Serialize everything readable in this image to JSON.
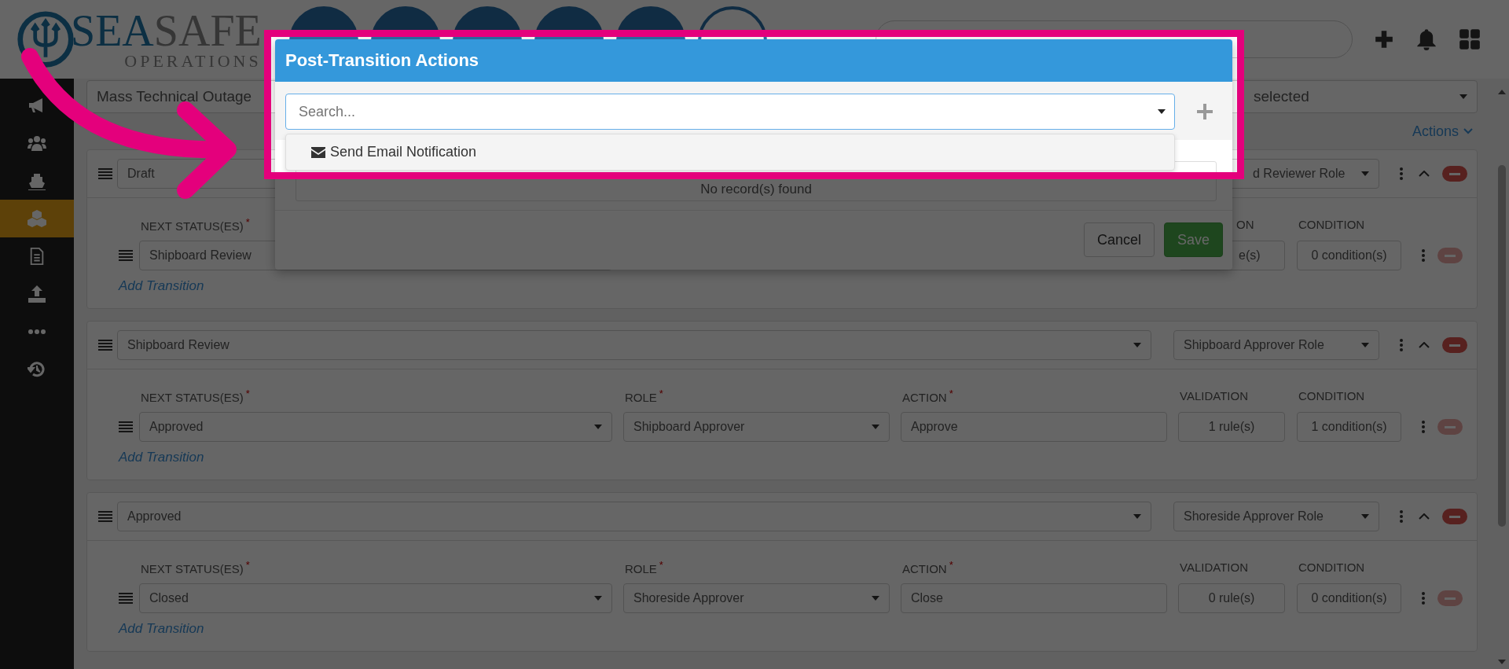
{
  "header": {
    "logo": {
      "brand_first": "SEA",
      "brand_second": "SAFE",
      "tagline": "OPERATIONS"
    },
    "nav_buttons": [
      {
        "kind": "filled"
      },
      {
        "kind": "filled"
      },
      {
        "kind": "filled"
      },
      {
        "kind": "filled"
      },
      {
        "kind": "filled"
      },
      {
        "kind": "outline"
      }
    ]
  },
  "sidebar": {
    "items": [
      {
        "selected": false
      },
      {
        "selected": false
      },
      {
        "selected": false
      },
      {
        "selected": true
      },
      {
        "selected": false
      },
      {
        "selected": false
      },
      {
        "selected": false
      },
      {
        "selected": false
      }
    ]
  },
  "filters": {
    "outage_type": "Mass Technical Outage",
    "selection": "selected"
  },
  "actions_link": "Actions",
  "sections": [
    {
      "status": "Draft",
      "role": "d Reviewer Role",
      "remove_disabled": false,
      "transitions": [
        {
          "next_status_label": {
            "text": "NEXT STATUS(ES)",
            "required_mark": "*"
          },
          "next_status": "Shipboard Review",
          "validation_label": "ON",
          "validation": "e(s)",
          "condition_label": "CONDITION",
          "condition": "0 condition(s)",
          "remove_disabled": true
        }
      ],
      "add_transition": "Add Transition"
    },
    {
      "status": "Shipboard Review",
      "role": "Shipboard Approver Role",
      "remove_disabled": false,
      "transitions": [
        {
          "next_status_label": {
            "text": "NEXT STATUS(ES)",
            "required_mark": "*"
          },
          "next_status": "Approved",
          "role_label": {
            "text": "ROLE",
            "required_mark": "*"
          },
          "role": "Shipboard Approver",
          "action_label": {
            "text": "ACTION",
            "required_mark": "*"
          },
          "action": "Approve",
          "validation_label": "VALIDATION",
          "validation": "1 rule(s)",
          "condition_label": "CONDITION",
          "condition": "1 condition(s)",
          "remove_disabled": true
        }
      ],
      "add_transition": "Add Transition"
    },
    {
      "status": "Approved",
      "role": "Shoreside Approver Role",
      "remove_disabled": false,
      "transitions": [
        {
          "next_status_label": {
            "text": "NEXT STATUS(ES)",
            "required_mark": "*"
          },
          "next_status": "Closed",
          "role_label": {
            "text": "ROLE",
            "required_mark": "*"
          },
          "role": "Shoreside Approver",
          "action_label": {
            "text": "ACTION",
            "required_mark": "*"
          },
          "action": "Close",
          "validation_label": "VALIDATION",
          "validation": "0 rule(s)",
          "condition_label": "CONDITION",
          "condition": "0 condition(s)",
          "remove_disabled": true
        }
      ],
      "add_transition": "Add Transition"
    }
  ],
  "modal": {
    "title": "Post-Transition Actions",
    "search_placeholder": "Search...",
    "options": [
      {
        "label": "Send Email Notification"
      }
    ],
    "empty_message": "No record(s) found",
    "buttons": {
      "cancel": "Cancel",
      "save": "Save"
    }
  }
}
